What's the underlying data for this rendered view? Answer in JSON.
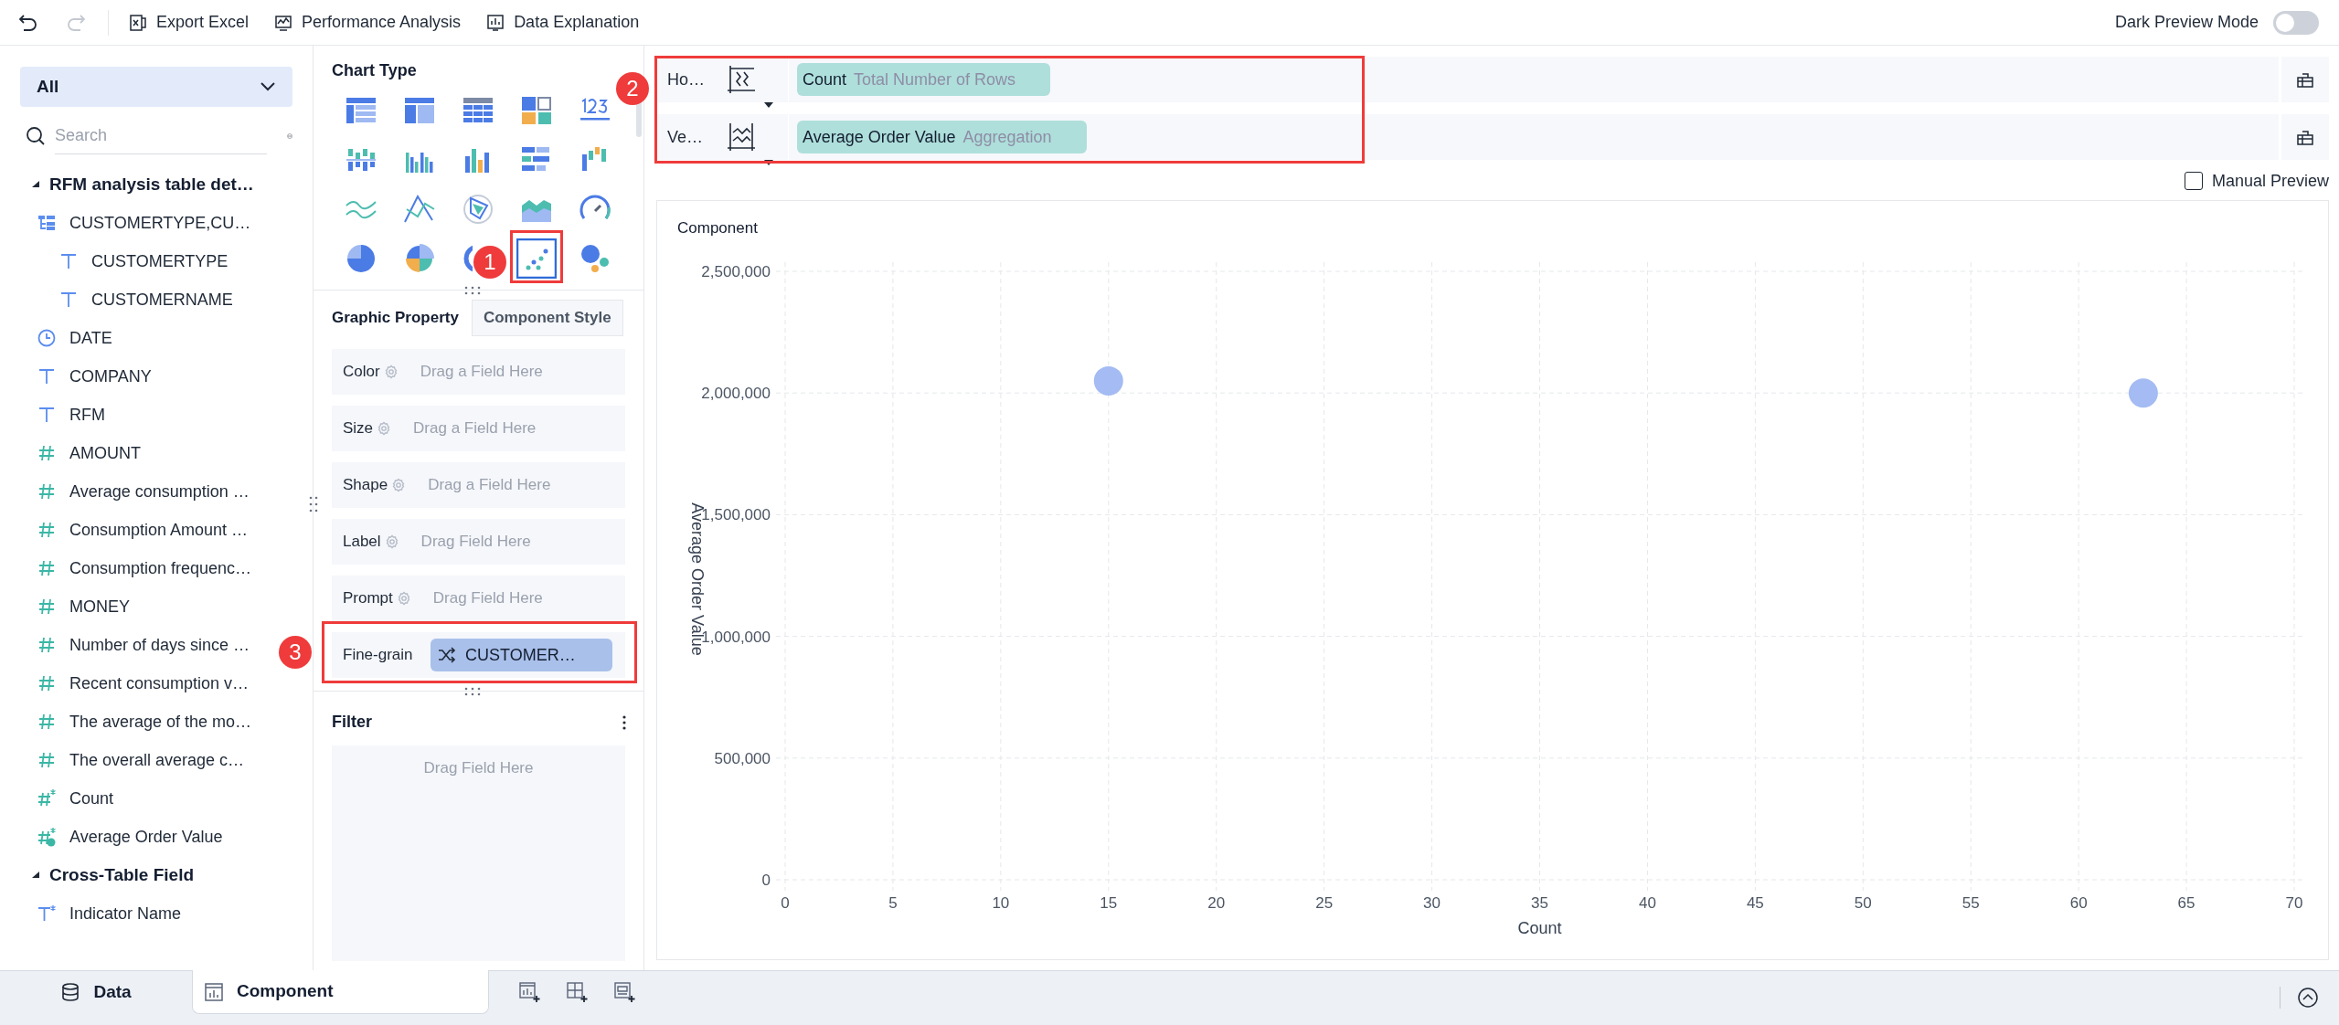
{
  "toolbar": {
    "undo": {
      "disabled": false
    },
    "redo": {
      "disabled": true
    },
    "buttons": [
      {
        "label": "Export Excel",
        "kind": "excel"
      },
      {
        "label": "Performance Analysis",
        "kind": "performance"
      },
      {
        "label": "Data Explanation",
        "kind": "explanation"
      }
    ],
    "dark_preview": {
      "label": "Dark Preview Mode",
      "on": false
    }
  },
  "sidebar": {
    "dropdown": {
      "value": "All"
    },
    "search": {
      "placeholder": "Search"
    },
    "tree": [
      {
        "label": "RFM analysis table det…",
        "kind": "section",
        "expanded": true,
        "children": [
          {
            "label": "CUSTOMERTYPE,CU…",
            "kind": "group",
            "children": [
              {
                "label": "CUSTOMERTYPE",
                "kind": "text"
              },
              {
                "label": "CUSTOMERNAME",
                "kind": "text"
              }
            ]
          },
          {
            "label": "DATE",
            "kind": "date"
          },
          {
            "label": "COMPANY",
            "kind": "text"
          },
          {
            "label": "RFM",
            "kind": "text"
          },
          {
            "label": "AMOUNT",
            "kind": "number"
          },
          {
            "label": "Average consumption …",
            "kind": "number"
          },
          {
            "label": "Consumption Amount …",
            "kind": "number"
          },
          {
            "label": "Consumption frequenc…",
            "kind": "number"
          },
          {
            "label": "MONEY",
            "kind": "number"
          },
          {
            "label": "Number of days since …",
            "kind": "number"
          },
          {
            "label": "Recent consumption v…",
            "kind": "number"
          },
          {
            "label": "The average of the mo…",
            "kind": "number"
          },
          {
            "label": "The overall average c…",
            "kind": "number"
          },
          {
            "label": "Count",
            "kind": "calc-number"
          },
          {
            "label": "Average Order Value",
            "kind": "calc-aggregate"
          }
        ]
      },
      {
        "label": "Cross-Table Field",
        "kind": "section",
        "expanded": true,
        "children": [
          {
            "label": "Indicator Name",
            "kind": "calc-text"
          }
        ]
      }
    ]
  },
  "chart_type": {
    "title": "Chart Type",
    "types": [
      {
        "kind": "table",
        "selected": false
      },
      {
        "kind": "cross-table",
        "selected": false
      },
      {
        "kind": "detail-table",
        "selected": false
      },
      {
        "kind": "tiles",
        "selected": false
      },
      {
        "kind": "number",
        "selected": false
      },
      {
        "kind": "grouped-bar",
        "selected": false
      },
      {
        "kind": "multi-bar",
        "selected": false
      },
      {
        "kind": "bar",
        "selected": false
      },
      {
        "kind": "horizontal-bar",
        "selected": false
      },
      {
        "kind": "waterfall",
        "selected": false
      },
      {
        "kind": "line",
        "selected": false
      },
      {
        "kind": "polyline",
        "selected": false
      },
      {
        "kind": "radar",
        "selected": false
      },
      {
        "kind": "area",
        "selected": false
      },
      {
        "kind": "gauge",
        "selected": false
      },
      {
        "kind": "pie",
        "selected": false
      },
      {
        "kind": "rose",
        "selected": false
      },
      {
        "kind": "ring",
        "selected": false
      },
      {
        "kind": "scatter",
        "selected": true
      },
      {
        "kind": "bubble",
        "selected": false
      }
    ]
  },
  "property_tabs": [
    {
      "label": "Graphic Property",
      "selected": true
    },
    {
      "label": "Component Style",
      "selected": false
    }
  ],
  "properties": [
    {
      "label": "Color",
      "hint": "Drag a Field Here"
    },
    {
      "label": "Size",
      "hint": "Drag a Field Here"
    },
    {
      "label": "Shape",
      "hint": "Drag a Field Here"
    },
    {
      "label": "Label",
      "hint": "Drag Field Here"
    },
    {
      "label": "Prompt",
      "hint": "Drag Field Here"
    },
    {
      "label": "Fine-grain",
      "value": "CUSTOMER…"
    }
  ],
  "filter": {
    "title": "Filter",
    "hint": "Drag Field Here"
  },
  "axes": [
    {
      "label": "Ho…",
      "kind": "horizontal",
      "field": "Count",
      "note": "Total Number of Rows"
    },
    {
      "label": "Ve…",
      "kind": "vertical",
      "field": "Average Order Value",
      "note": "Aggregation"
    }
  ],
  "manual_preview": {
    "label": "Manual Preview",
    "checked": false
  },
  "component": {
    "chart_data": {
      "type": "scatter",
      "title": "Component",
      "xlabel": "Count",
      "ylabel": "Average Order Value",
      "x": [
        15,
        63
      ],
      "grid": true,
      "series": [
        {
          "color": "#a4bbf3",
          "values": [
            2050000,
            2000000
          ]
        }
      ],
      "xlim": [
        0,
        70
      ],
      "ylim": [
        0,
        2500000
      ],
      "xticks": [
        0,
        5,
        10,
        15,
        20,
        25,
        30,
        35,
        40,
        45,
        50,
        55,
        60,
        65,
        70
      ],
      "yticks": [
        {
          "value": 0,
          "label": "0"
        },
        {
          "value": 500000,
          "label": "500,000"
        },
        {
          "value": 1000000,
          "label": "1,000,000"
        },
        {
          "value": 1500000,
          "label": "1,500,000"
        },
        {
          "value": 2000000,
          "label": "2,000,000"
        },
        {
          "value": 2500000,
          "label": "2,500,000"
        }
      ]
    }
  },
  "bottom_tabs": [
    {
      "label": "Data",
      "kind": "data",
      "selected": false
    },
    {
      "label": "Component",
      "kind": "component",
      "selected": true
    }
  ],
  "annotations": [
    {
      "label": "1"
    },
    {
      "label": "2"
    },
    {
      "label": "3"
    }
  ]
}
